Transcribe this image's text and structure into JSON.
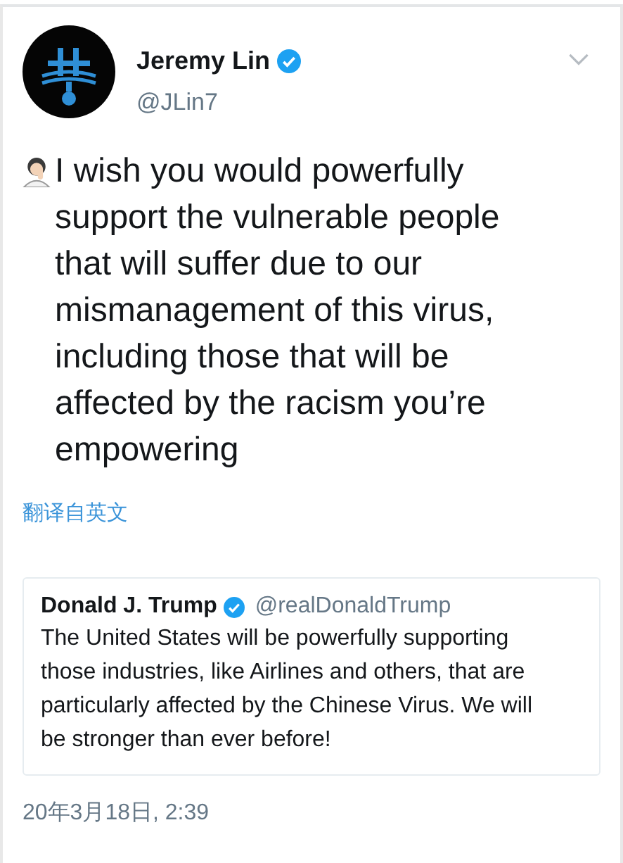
{
  "tweet": {
    "author": {
      "name": "Jeremy Lin",
      "handle": "@JLin7",
      "verified": true
    },
    "text": "I wish you would powerfully support the vulnerable people that will suffer due to our mismanagement of this virus, including those that will be affected by the racism you’re empowering",
    "translate_link": "翻译自英文",
    "quoted": {
      "name": "Donald J. Trump",
      "handle": "@realDonaldTrump",
      "verified": true,
      "text": "The United States will be powerfully supporting those industries, like Airlines and others, that are particularly affected by the Chinese Virus. We will be stronger than ever before!"
    },
    "timestamp": "20年3月18日, 2:39"
  }
}
